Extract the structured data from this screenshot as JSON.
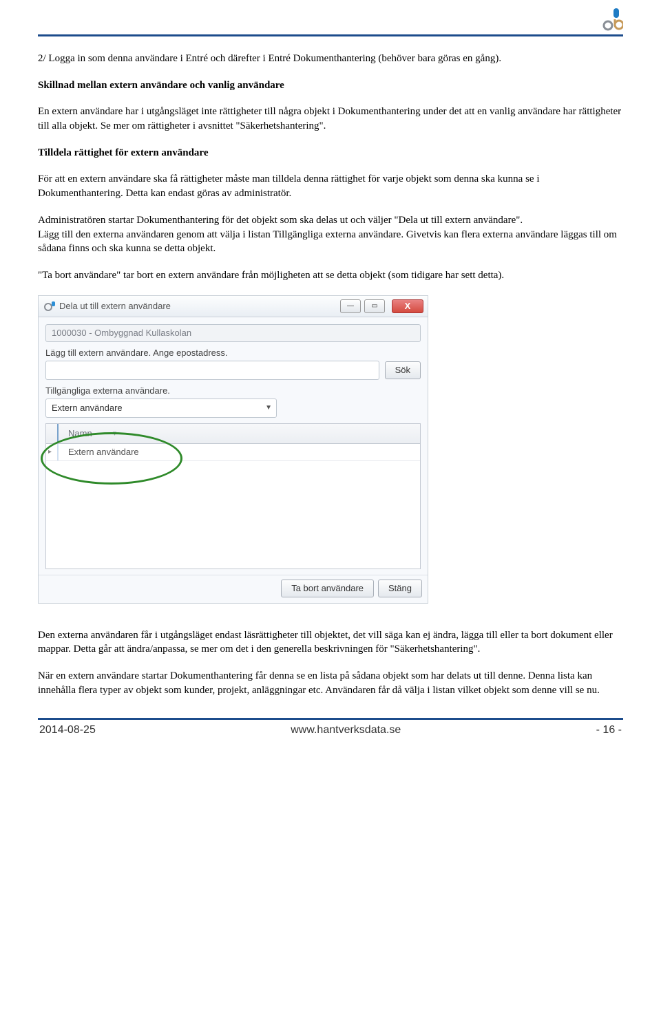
{
  "logo_label": "ab",
  "body": {
    "p1": "2/ Logga in som denna användare i Entré och därefter i Entré Dokumenthantering (behöver bara göras en gång).",
    "h1": "Skillnad mellan extern användare och vanlig användare",
    "p2": "En extern användare har i utgångsläget inte rättigheter till några objekt i Dokumenthantering under det att en vanlig användare har rättigheter till alla objekt. Se mer om rättigheter i avsnittet \"Säkerhetshantering\".",
    "h2": "Tilldela rättighet för extern användare",
    "p3": "För att en extern användare ska få rättigheter måste man tilldela denna rättighet för varje objekt som denna ska kunna se i Dokumenthantering. Detta kan endast göras av administratör.",
    "p4": "Administratören startar Dokumenthantering för det objekt som ska delas ut och väljer \"Dela ut till extern användare\".",
    "p5": "Lägg till den externa användaren genom att välja i listan Tillgängliga externa användare. Givetvis kan flera externa användare läggas till om sådana finns och ska kunna se detta objekt.",
    "p6": "\"Ta bort användare\" tar bort en extern användare från möjligheten att se detta objekt (som tidigare har sett detta).",
    "p7": "Den externa användaren får i utgångsläget endast läsrättigheter till objektet, det vill säga kan ej ändra, lägga till eller ta bort dokument eller mappar. Detta går att ändra/anpassa, se mer om det i den generella beskrivningen för \"Säkerhetshantering\".",
    "p8": "När en extern användare startar Dokumenthantering får denna se en lista på sådana objekt som har delats ut till denne. Denna lista kan innehålla flera typer av objekt som kunder, projekt, anläggningar etc. Användaren får då välja i listan vilket objekt som denne vill se nu."
  },
  "dialog": {
    "title": "Dela ut till extern användare",
    "project": "1000030 - Ombyggnad Kullaskolan",
    "add_label": "Lägg till extern användare. Ange epostadress.",
    "search_btn": "Sök",
    "avail_label": "Tillgängliga externa användare.",
    "dropdown_value": "Extern användare",
    "col_name": "Namn",
    "row_value": "Extern användare",
    "remove_btn": "Ta bort användare",
    "close_btn": "Stäng"
  },
  "footer": {
    "date": "2014-08-25",
    "url": "www.hantverksdata.se",
    "page": "- 16 -"
  }
}
